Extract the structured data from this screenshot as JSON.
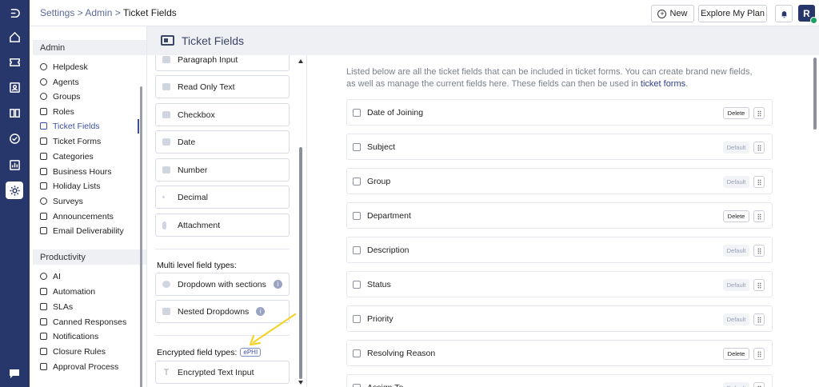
{
  "breadcrumb": {
    "part1": "Settings",
    "sep1": " > ",
    "part2": "Admin",
    "sep2": " > ",
    "current": "Ticket Fields"
  },
  "header": {
    "new_label": "New",
    "plan_label": "Explore My Plan",
    "avatar_initial": "R"
  },
  "rail": {
    "icons": [
      "logo-icon",
      "home-icon",
      "ticket-icon",
      "contact-icon",
      "book-icon",
      "check-icon",
      "report-icon",
      "settings-icon"
    ],
    "active": "settings-icon"
  },
  "sidebar": {
    "admin_title": "Admin",
    "admin_items": [
      {
        "label": "Helpdesk",
        "icon": "globe-icon"
      },
      {
        "label": "Agents",
        "icon": "agent-icon"
      },
      {
        "label": "Groups",
        "icon": "groups-icon"
      },
      {
        "label": "Roles",
        "icon": "roles-icon"
      },
      {
        "label": "Ticket Fields",
        "icon": "ticket-fields-icon",
        "active": true
      },
      {
        "label": "Ticket Forms",
        "icon": "forms-icon"
      },
      {
        "label": "Categories",
        "icon": "categories-icon"
      },
      {
        "label": "Business Hours",
        "icon": "hourglass-icon"
      },
      {
        "label": "Holiday Lists",
        "icon": "calendar-icon"
      },
      {
        "label": "Surveys",
        "icon": "smiley-icon"
      },
      {
        "label": "Announcements",
        "icon": "megaphone-icon"
      },
      {
        "label": "Email Deliverability",
        "icon": "email-icon"
      }
    ],
    "productivity_title": "Productivity",
    "productivity_items": [
      {
        "label": "AI",
        "icon": "ai-icon"
      },
      {
        "label": "Automation",
        "icon": "automation-icon"
      },
      {
        "label": "SLAs",
        "icon": "sla-icon"
      },
      {
        "label": "Canned Responses",
        "icon": "canned-icon"
      },
      {
        "label": "Notifications",
        "icon": "bell-icon"
      },
      {
        "label": "Closure Rules",
        "icon": "closure-icon"
      },
      {
        "label": "Approval Process",
        "icon": "approval-icon"
      }
    ]
  },
  "main": {
    "title": "Ticket Fields"
  },
  "palette": {
    "basic_items": [
      "Paragraph Input",
      "Read Only Text",
      "Checkbox",
      "Date",
      "Number",
      "Decimal",
      "Attachment"
    ],
    "multi_level_label": "Multi level field types:",
    "multi_level_items": [
      "Dropdown with sections",
      "Nested Dropdowns"
    ],
    "encrypted_label": "Encrypted field types:",
    "ephi_badge": "ePHI",
    "encrypted_items": [
      "Encrypted Text Input"
    ],
    "info_glyph": "i"
  },
  "content": {
    "intro_text": "Listed below are all the ticket fields that can be included in ticket forms. You can create brand new fields, as well as manage the current fields here. These fields can then be used in ",
    "intro_link": "ticket forms",
    "intro_end": ".",
    "fields": [
      {
        "name": "Date of Joining",
        "tag": "Delete"
      },
      {
        "name": "Subject",
        "tag": "Default"
      },
      {
        "name": "Group",
        "tag": "Default"
      },
      {
        "name": "Department",
        "tag": "Delete"
      },
      {
        "name": "Description",
        "tag": "Default"
      },
      {
        "name": "Status",
        "tag": "Default"
      },
      {
        "name": "Priority",
        "tag": "Default"
      },
      {
        "name": "Resolving Reason",
        "tag": "Delete"
      },
      {
        "name": "Assign To",
        "tag": "Default"
      }
    ]
  },
  "colors": {
    "rail": "#27366b",
    "accent": "#3b4fa0",
    "annotation_arrow": "#f5d22a"
  }
}
